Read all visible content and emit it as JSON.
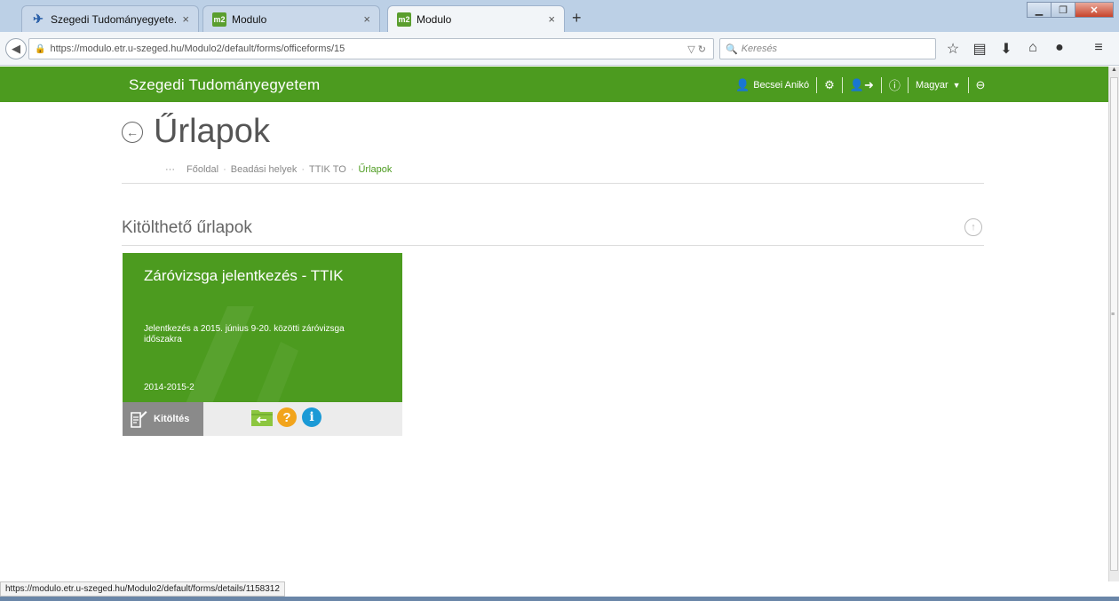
{
  "browser": {
    "tabs": [
      {
        "label": "Szegedi Tudományegyete...",
        "close": "×"
      },
      {
        "label": "Modulo",
        "close": "×"
      },
      {
        "label": "Modulo",
        "close": "×"
      }
    ],
    "new_tab": "+",
    "url": "https://modulo.etr.u-szeged.hu/Modulo2/default/forms/officeforms/15",
    "search_placeholder": "Keresés",
    "favicon_text": "m2"
  },
  "app": {
    "brand": "Szegedi Tudományegyetem",
    "user_name": "Becsei Anikó",
    "language": "Magyar"
  },
  "page": {
    "title": "Űrlapok",
    "breadcrumb": {
      "ellipsis": "···",
      "items": [
        "Főoldal",
        "Beadási helyek",
        "TTIK TO",
        "Űrlapok"
      ]
    },
    "section_title": "Kitölthető űrlapok"
  },
  "card": {
    "title": "Záróvizsga jelentkezés - TTIK",
    "description": "Jelentkezés a 2015. június 9-20. közötti záróvizsga időszakra",
    "period": "2014-2015-2",
    "fill_button": "Kitöltés"
  },
  "status_url": "https://modulo.etr.u-szeged.hu/Modulo2/default/forms/details/1158312",
  "colors": {
    "brand_green": "#4c9b1f",
    "help_orange": "#f2a41c",
    "info_blue": "#1b9ad6",
    "fill_gray": "#8a8a8a"
  },
  "icons": [
    "back-icon",
    "lock-icon",
    "search-icon",
    "bookmark-star-icon",
    "reading-list-icon",
    "download-icon",
    "home-icon",
    "chat-icon",
    "menu-icon",
    "user-icon",
    "gear-icon",
    "switch-user-icon",
    "help-icon",
    "logout-icon",
    "up-arrow-icon",
    "document-edit-icon",
    "folder-back-icon",
    "question-icon",
    "info-icon"
  ]
}
